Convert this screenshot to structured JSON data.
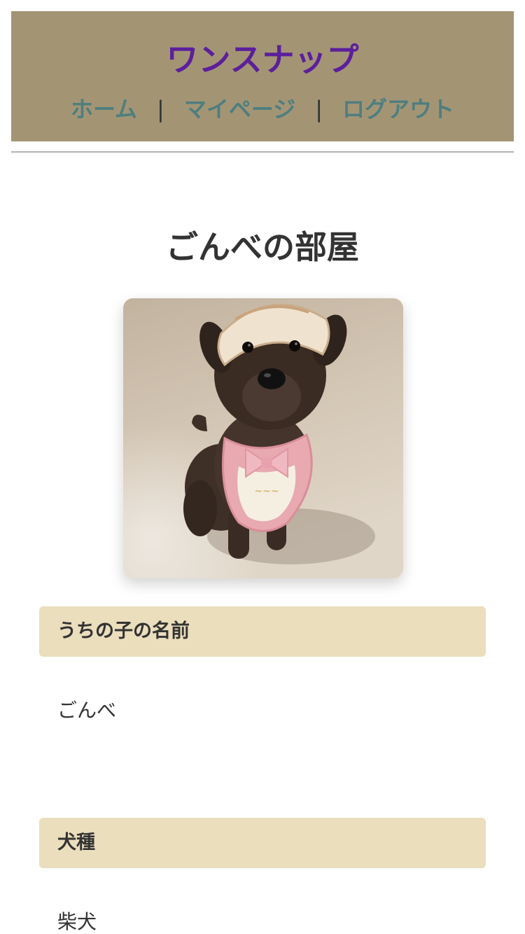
{
  "header": {
    "title": "ワンスナップ",
    "nav": [
      {
        "label": "ホーム"
      },
      {
        "label": "マイページ"
      },
      {
        "label": "ログアウト"
      }
    ],
    "separator": "|"
  },
  "page_title": "ごんべの部屋",
  "photo": {
    "subject": "dog-photo"
  },
  "sections": [
    {
      "heading": "うちの子の名前",
      "value": "ごんべ"
    },
    {
      "heading": "犬種",
      "value": "柴犬"
    }
  ],
  "colors": {
    "header_bg": "#a39574",
    "title": "#5c1f9c",
    "nav_link": "#4f7e7f",
    "section_bg": "#ebdebd",
    "text": "#333333"
  }
}
